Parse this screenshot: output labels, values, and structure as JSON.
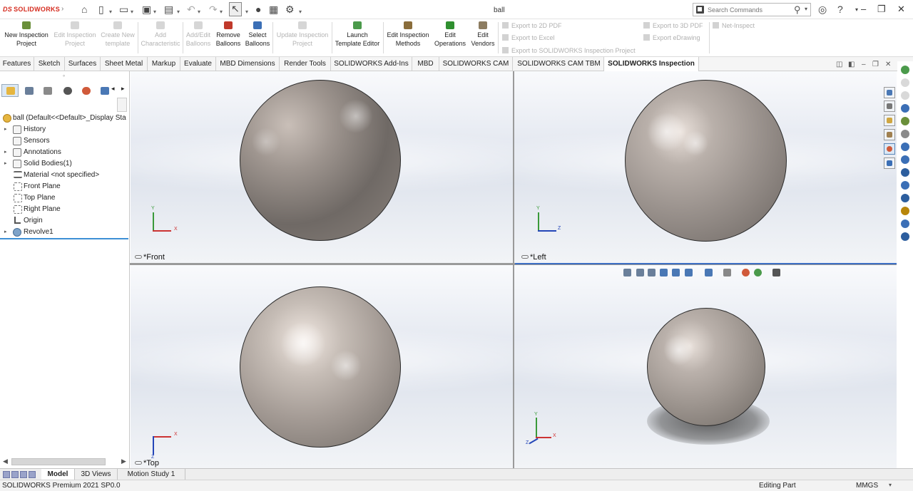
{
  "app": {
    "logo_text": "SOLIDWORKS",
    "document_title": "ball",
    "search_placeholder": "Search Commands"
  },
  "commands": {
    "new_inspection_project": [
      "New Inspection",
      "Project"
    ],
    "edit_inspection_project": [
      "Edit Inspection",
      "Project"
    ],
    "create_new_template": [
      "Create New",
      "template"
    ],
    "add_characteristic": [
      "Add",
      "Characteristic"
    ],
    "add_edit_balloons": [
      "Add/Edit",
      "Balloons"
    ],
    "remove_balloons": [
      "Remove",
      "Balloons"
    ],
    "select_balloons": [
      "Select",
      "Balloons"
    ],
    "update_inspection_project": [
      "Update Inspection",
      "Project"
    ],
    "launch_template_editor": [
      "Launch",
      "Template Editor"
    ],
    "edit_inspection_methods": [
      "Edit Inspection",
      "Methods"
    ],
    "edit_operations": [
      "Edit",
      "Operations"
    ],
    "edit_vendors": [
      "Edit",
      "Vendors"
    ],
    "export_2d_pdf": "Export to 2D PDF",
    "export_excel": "Export to Excel",
    "export_swi_project": "Export to SOLIDWORKS Inspection Project",
    "export_3d_pdf": "Export to 3D PDF",
    "export_edrawing": "Export eDrawing",
    "net_inspect": "Net-Inspect"
  },
  "tabs": [
    "Features",
    "Sketch",
    "Surfaces",
    "Sheet Metal",
    "Markup",
    "Evaluate",
    "MBD Dimensions",
    "Render Tools",
    "SOLIDWORKS Add-Ins",
    "MBD",
    "SOLIDWORKS CAM",
    "SOLIDWORKS CAM TBM",
    "SOLIDWORKS Inspection"
  ],
  "active_tab": "SOLIDWORKS Inspection",
  "feature_tree": {
    "root": "ball  (Default<<Default>_Display Sta",
    "items": [
      "History",
      "Sensors",
      "Annotations",
      "Solid Bodies(1)",
      "Material <not specified>",
      "Front Plane",
      "Top Plane",
      "Right Plane",
      "Origin",
      "Revolve1"
    ]
  },
  "viewports": {
    "front": "*Front",
    "left": "*Left",
    "top": "*Top"
  },
  "axis_labels": {
    "x": "X",
    "y": "Y",
    "z": "Z"
  },
  "bottom_tabs": [
    "Model",
    "3D Views",
    "Motion Study 1"
  ],
  "status": {
    "product": "SOLIDWORKS Premium 2021 SP0.0",
    "mode": "Editing Part",
    "units": "MMGS"
  }
}
